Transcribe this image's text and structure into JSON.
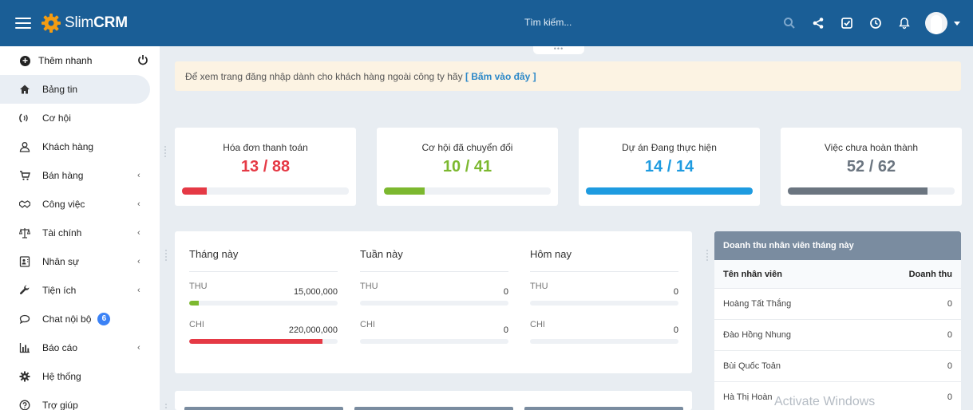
{
  "app": {
    "brand_regular": "Slim",
    "brand_bold": "CRM"
  },
  "search": {
    "placeholder": "Tìm kiếm..."
  },
  "topbar_icons": [
    "search-icon",
    "share-icon",
    "task-check-icon",
    "clock-icon",
    "bell-icon"
  ],
  "sidebar": {
    "quick_add": "Thêm nhanh",
    "items": [
      {
        "label": "Bảng tin",
        "icon": "home-icon",
        "active": true,
        "has_submenu": false
      },
      {
        "label": "Cơ hội",
        "icon": "signal-icon",
        "has_submenu": false
      },
      {
        "label": "Khách hàng",
        "icon": "user-icon",
        "has_submenu": false
      },
      {
        "label": "Bán hàng",
        "icon": "cart-icon",
        "has_submenu": true
      },
      {
        "label": "Công việc",
        "icon": "handshake-icon",
        "has_submenu": true
      },
      {
        "label": "Tài chính",
        "icon": "scale-icon",
        "has_submenu": true
      },
      {
        "label": "Nhân sự",
        "icon": "id-card-icon",
        "has_submenu": true
      },
      {
        "label": "Tiện ích",
        "icon": "wrench-icon",
        "has_submenu": true
      },
      {
        "label": "Chat nội bộ",
        "icon": "chat-icon",
        "badge": "6",
        "has_submenu": false
      },
      {
        "label": "Báo cáo",
        "icon": "bar-chart-icon",
        "has_submenu": true
      },
      {
        "label": "Hệ thống",
        "icon": "gear-icon",
        "has_submenu": false
      },
      {
        "label": "Trợ giúp",
        "icon": "help-icon",
        "has_submenu": false
      }
    ]
  },
  "notice": {
    "text": "Để xem trang đăng nhập dành cho khách hàng ngoài công ty hãy",
    "link": "[ Bấm vào đây ]"
  },
  "stats": [
    {
      "title": "Hóa đơn thanh toán",
      "value": "13 / 88",
      "progress": 0.148,
      "color": "#e53945"
    },
    {
      "title": "Cơ hội đã chuyển đổi",
      "value": "10 / 41",
      "progress": 0.244,
      "color": "#7cb82f"
    },
    {
      "title": "Dự án Đang thực hiện",
      "value": "14 / 14",
      "progress": 1.0,
      "color": "#1e9be0"
    },
    {
      "title": "Việc chưa hoàn thành",
      "value": "52 / 62",
      "progress": 0.839,
      "color": "#6b7580"
    }
  ],
  "summary": [
    {
      "heading": "Tháng này",
      "thu_label": "THU",
      "thu_value": "15,000,000",
      "thu_progress": 0.064,
      "chi_label": "CHI",
      "chi_value": "220,000,000",
      "chi_progress": 0.9
    },
    {
      "heading": "Tuần này",
      "thu_label": "THU",
      "thu_value": "0",
      "thu_progress": 0,
      "chi_label": "CHI",
      "chi_value": "0",
      "chi_progress": 0
    },
    {
      "heading": "Hôm nay",
      "thu_label": "THU",
      "thu_value": "0",
      "thu_progress": 0,
      "chi_label": "CHI",
      "chi_value": "0",
      "chi_progress": 0
    }
  ],
  "colors": {
    "thu": "#7cb82f",
    "chi": "#e53945"
  },
  "revenue": {
    "title": "Doanh thu nhân viên tháng này",
    "col_name": "Tên nhân viên",
    "col_value": "Doanh thu",
    "rows": [
      {
        "name": "Hoàng Tất Thắng",
        "value": "0"
      },
      {
        "name": "Đào Hồng Nhung",
        "value": "0"
      },
      {
        "name": "Bùi Quốc Toản",
        "value": "0"
      },
      {
        "name": "Hà Thị Hoàn",
        "value": "0"
      }
    ]
  },
  "watermark": "Activate Windows"
}
